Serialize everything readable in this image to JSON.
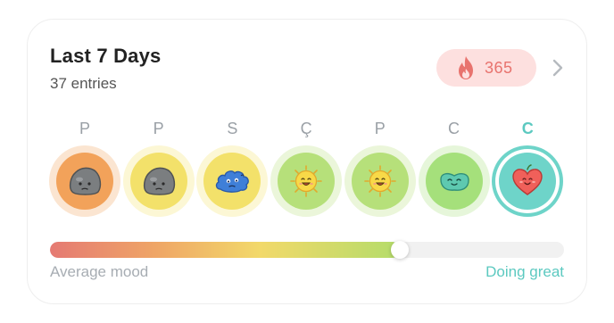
{
  "header": {
    "title": "Last 7 Days",
    "subtitle": "37 entries"
  },
  "streak": {
    "count": "365",
    "icon": "flame-icon",
    "color": "#e8736e",
    "background": "#fde0df"
  },
  "days": [
    {
      "letter": "P",
      "mood": "sad-rock",
      "color": "#f2a25a"
    },
    {
      "letter": "P",
      "mood": "sad-rock",
      "color": "#f3e16a"
    },
    {
      "letter": "S",
      "mood": "worried-cloud",
      "color": "#f3e16a"
    },
    {
      "letter": "Ç",
      "mood": "happy-sun",
      "color": "#b6e07a"
    },
    {
      "letter": "P",
      "mood": "happy-sun",
      "color": "#b6e07a"
    },
    {
      "letter": "C",
      "mood": "content-bean",
      "color": "#a5e07b"
    },
    {
      "letter": "C",
      "mood": "loving-heart",
      "color": "#6ed4c9",
      "today": true
    }
  ],
  "mood_bar": {
    "level": 0.68,
    "label_left": "Average mood",
    "label_right": "Doing great",
    "accent": "#5cc9c0"
  }
}
